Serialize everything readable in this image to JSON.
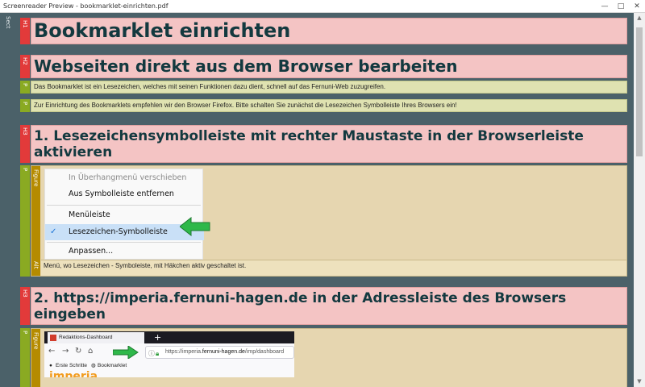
{
  "window": {
    "title": "Screenreader Preview - bookmarklet-einrichten.pdf",
    "min": "—",
    "max": "□",
    "close": "✕"
  },
  "labels": {
    "sect": "Sect",
    "h1": "H1",
    "h2": "H2",
    "h3": "H3",
    "p": "P",
    "figure": "Figure",
    "alt": "Alt"
  },
  "content": {
    "h1": "Bookmarklet einrichten",
    "h2": "Webseiten direkt aus dem Browser bearbeiten",
    "p1": "Das Bookmarklet ist ein Lesezeichen, welches mit seinen Funktionen dazu dient, schnell auf das Fernuni-Web zuzugreifen.",
    "p2": "Zur Einrichtung des Bookmarklets empfehlen wir den Browser Firefox. Bitte schalten Sie zunächst die Lesezeichen Symbolleiste Ihres Browsers ein!",
    "h3_1": "1. Lesezeichensymbolleiste mit rechter Maustaste in der Browserleiste aktivieren",
    "figure1_alt": "Menü, wo Lesezeichen - Symboleiste, mit Häkchen aktiv geschaltet ist.",
    "h3_2": "2. https://imperia.fernuni-hagen.de in der Adressleiste des Browsers eingeben"
  },
  "context_menu": {
    "items": [
      {
        "label": "In Überhangmenü verschieben",
        "disabled": true
      },
      {
        "label": "Aus Symbolleiste entfernen",
        "disabled": false
      },
      {
        "label": "Menüleiste",
        "disabled": false
      },
      {
        "label": "Lesezeichen-Symbolleiste",
        "disabled": false,
        "checked": true
      },
      {
        "label": "Anpassen...",
        "disabled": false
      }
    ],
    "checkmark": "✓",
    "arrow_color": "#2fb84a"
  },
  "browser": {
    "tab_title": "Redaktions-Dashboard",
    "new_tab": "+",
    "url_prefix": "https://imperia.",
    "url_domain": "fernuni-hagen.de",
    "url_path": "/imp/dashboard",
    "bookmarks": [
      "Erste Schritte",
      "Bookmarklet"
    ],
    "logo_text": "imperia"
  },
  "colors": {
    "heading_bg": "#f4c4c4",
    "heading_tag": "#e23a3a",
    "para_bg": "#dfe2b1",
    "para_tag": "#8aaa22",
    "figure_bg": "#e6d6b0",
    "figure_tag": "#b58b00",
    "canvas": "#4b6169"
  }
}
